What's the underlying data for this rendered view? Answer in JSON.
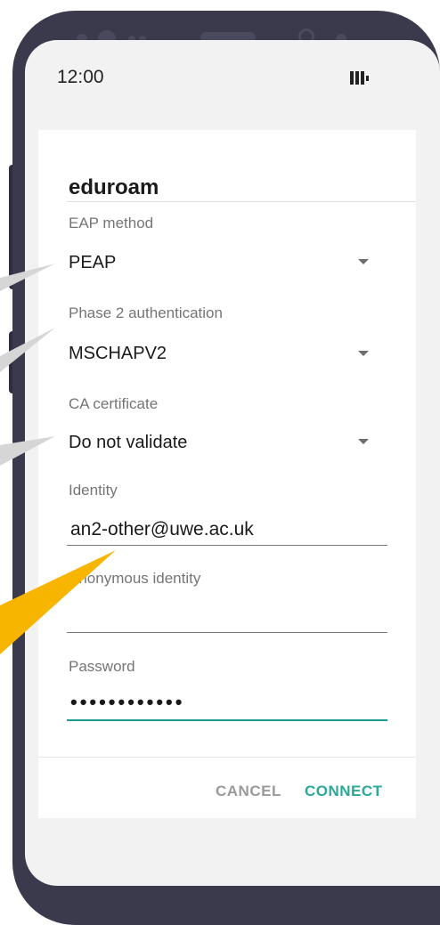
{
  "status_bar": {
    "time": "12:00"
  },
  "dialog": {
    "title": "eduroam",
    "eap_method": {
      "label": "EAP method",
      "value": "PEAP"
    },
    "phase2": {
      "label": "Phase 2 authentication",
      "value": "MSCHAPV2"
    },
    "ca_cert": {
      "label": "CA certificate",
      "value": "Do not validate"
    },
    "identity": {
      "label": "Identity",
      "value": "an2-other@uwe.ac.uk"
    },
    "anonymous_identity": {
      "label": "Anonymous identity",
      "value": ""
    },
    "password": {
      "label": "Password",
      "value": "••••••••••••"
    },
    "buttons": {
      "cancel": "CANCEL",
      "connect": "CONNECT"
    }
  },
  "colors": {
    "phone_body": "#3a3a4c",
    "accent": "#2aa899",
    "callout_grey": "#d6d6d6",
    "callout_yellow": "#f7b500"
  }
}
